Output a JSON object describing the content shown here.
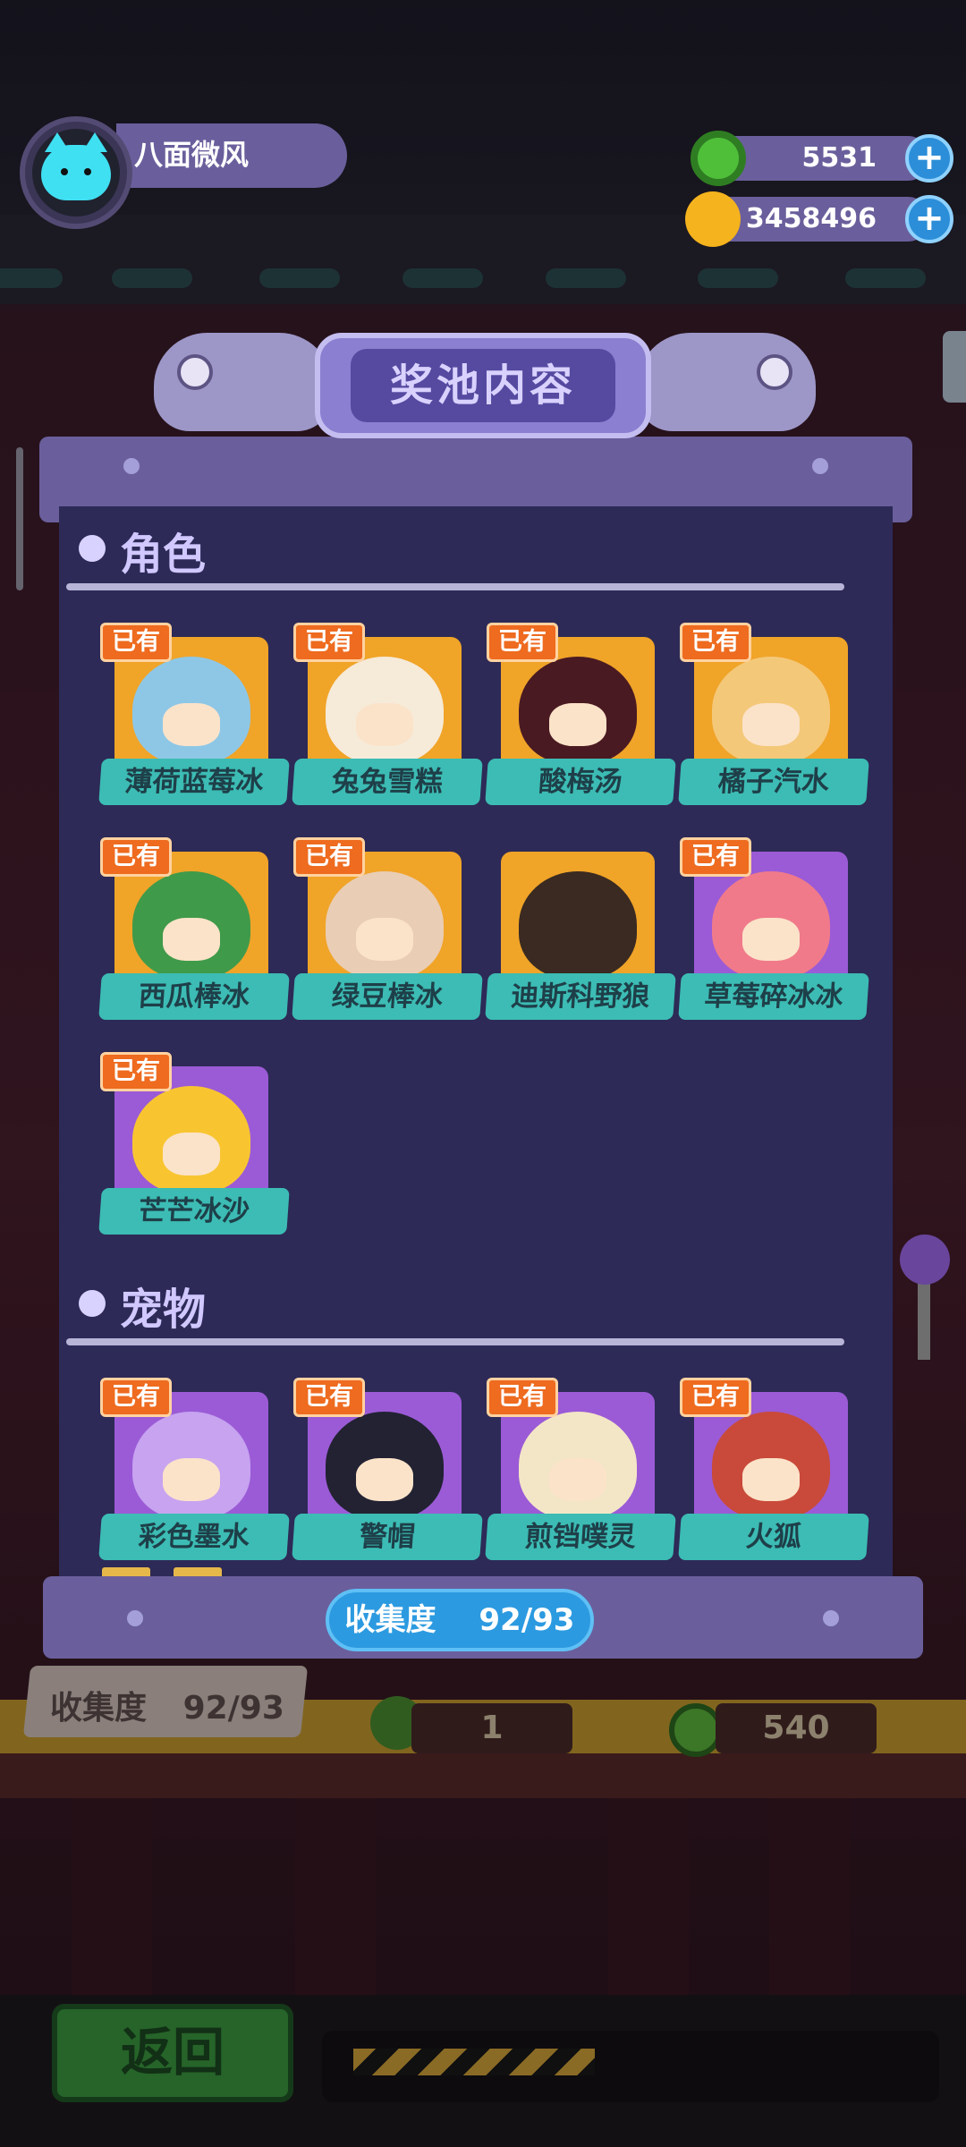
{
  "player": {
    "name": "八面微风",
    "avatar_icon": "cat-face-icon"
  },
  "currency": [
    {
      "name": "green-donut-coin",
      "value": "5531",
      "color": "#4fbf3a"
    },
    {
      "name": "gold-planet-coin",
      "value": "3458496",
      "color": "#f5b31d"
    }
  ],
  "modal": {
    "title": "奖池内容",
    "owned_badge": "已有",
    "sections": [
      {
        "title": "角色",
        "items": [
          {
            "label": "薄荷蓝莓冰",
            "owned": true,
            "tile": "orange",
            "color": "#8ec7e6"
          },
          {
            "label": "兔兔雪糕",
            "owned": true,
            "tile": "orange",
            "color": "#f6ead9"
          },
          {
            "label": "酸梅汤",
            "owned": true,
            "tile": "orange",
            "color": "#4a1a22"
          },
          {
            "label": "橘子汽水",
            "owned": true,
            "tile": "orange",
            "color": "#f4c879"
          },
          {
            "label": "西瓜棒冰",
            "owned": true,
            "tile": "orange",
            "color": "#3f9a4a"
          },
          {
            "label": "绿豆棒冰",
            "owned": true,
            "tile": "orange",
            "color": "#e9cdb5"
          },
          {
            "label": "迪斯科野狼",
            "owned": false,
            "tile": "orange",
            "color": "#1a1520"
          },
          {
            "label": "草莓碎冰冰",
            "owned": true,
            "tile": "purple",
            "color": "#f07a8a"
          },
          {
            "label": "芒芒冰沙",
            "owned": true,
            "tile": "purple",
            "color": "#f8c531"
          }
        ]
      },
      {
        "title": "宠物",
        "items": [
          {
            "label": "彩色墨水",
            "owned": true,
            "tile": "purple",
            "color": "#c7a3f0"
          },
          {
            "label": "警帽",
            "owned": true,
            "tile": "purple",
            "color": "#222233"
          },
          {
            "label": "煎铛噗灵",
            "owned": true,
            "tile": "purple",
            "color": "#f3e6c6"
          },
          {
            "label": "火狐",
            "owned": true,
            "tile": "purple",
            "color": "#c94a3a"
          }
        ]
      }
    ],
    "collection": {
      "label": "收集度",
      "value": "92/93"
    }
  },
  "background": {
    "collection_label": "收集度",
    "collection_value": "92/93",
    "prize_counts": [
      "1",
      "540"
    ],
    "back_label": "返回"
  }
}
